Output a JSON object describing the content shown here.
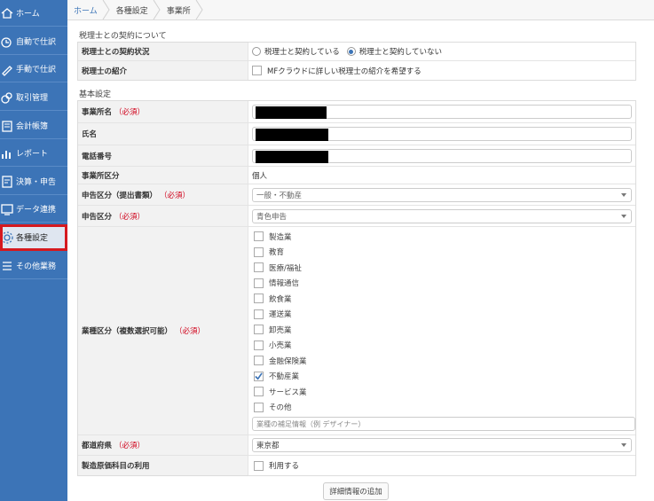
{
  "sidebar": {
    "items": [
      {
        "label": "ホーム",
        "icon": "home-icon"
      },
      {
        "label": "自動で仕訳",
        "icon": "auto-journal-icon"
      },
      {
        "label": "手動で仕訳",
        "icon": "manual-journal-icon"
      },
      {
        "label": "取引管理",
        "icon": "transaction-icon"
      },
      {
        "label": "会計帳簿",
        "icon": "ledger-icon"
      },
      {
        "label": "レポート",
        "icon": "report-icon"
      },
      {
        "label": "決算・申告",
        "icon": "settlement-icon"
      },
      {
        "label": "データ連携",
        "icon": "data-link-icon"
      },
      {
        "label": "各種設定",
        "icon": "settings-icon",
        "active": true
      },
      {
        "label": "その他業務",
        "icon": "menu-icon"
      }
    ]
  },
  "breadcrumb": [
    "ホーム",
    "各種設定",
    "事業所"
  ],
  "tax_section": {
    "title": "税理士との契約について",
    "contract_label": "税理士との契約状況",
    "contract_options": [
      "税理士と契約している",
      "税理士と契約していない"
    ],
    "contract_selected": 1,
    "intro_label": "税理士の紹介",
    "intro_option": "MFクラウドに詳しい税理士の紹介を希望する"
  },
  "basic_section": {
    "title": "基本設定",
    "required": "（必須）",
    "office_name_label": "事業所名",
    "name_label": "氏名",
    "phone_label": "電話番号",
    "office_type_label": "事業所区分",
    "office_type_value": "個人",
    "filing_type_label": "申告区分（提出書類）",
    "filing_type_value": "一般・不動産",
    "declaration_label": "申告区分",
    "declaration_value": "青色申告",
    "industry_label": "業種区分（複数選択可能）",
    "industries": [
      {
        "name": "製造業",
        "checked": false
      },
      {
        "name": "教育",
        "checked": false
      },
      {
        "name": "医療/福祉",
        "checked": false
      },
      {
        "name": "情報通信",
        "checked": false
      },
      {
        "name": "飲食業",
        "checked": false
      },
      {
        "name": "運送業",
        "checked": false
      },
      {
        "name": "卸売業",
        "checked": false
      },
      {
        "name": "小売業",
        "checked": false
      },
      {
        "name": "金融保険業",
        "checked": false
      },
      {
        "name": "不動産業",
        "checked": true
      },
      {
        "name": "サービス業",
        "checked": false
      },
      {
        "name": "その他",
        "checked": false
      }
    ],
    "industry_placeholder": "業種の補足情報（例 デザイナー）",
    "prefecture_label": "都道府県",
    "prefecture_value": "東京都",
    "cost_label": "製造原価科目の利用",
    "cost_option": "利用する"
  },
  "add_button": "詳細情報の追加"
}
